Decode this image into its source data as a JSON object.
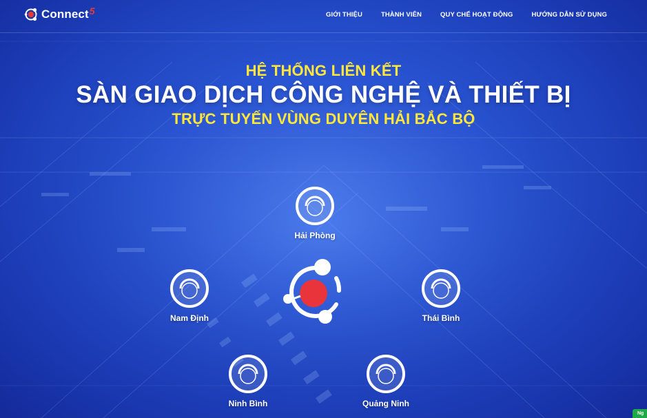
{
  "brand": {
    "name": "Connect",
    "superscript": "5"
  },
  "nav": [
    {
      "label": "GIỚI THIỆU"
    },
    {
      "label": "THÀNH VIÊN"
    },
    {
      "label": "QUY CHẾ HOẠT ĐỘNG"
    },
    {
      "label": "HƯỚNG DẪN SỬ DỤNG"
    }
  ],
  "hero": {
    "line1": "HỆ THỐNG LIÊN KẾT",
    "line2": "SÀN GIAO DỊCH CÔNG NGHỆ VÀ THIẾT BỊ",
    "line3": "TRỰC TUYẾN VÙNG DUYÊN HẢI BẮC BỘ"
  },
  "provinces": [
    {
      "name": "Hải Phòng"
    },
    {
      "name": "Nam Định"
    },
    {
      "name": "Thái Bình"
    },
    {
      "name": "Ninh Bình"
    },
    {
      "name": "Quảng Ninh"
    }
  ],
  "chat_widget": {
    "label": "Ng"
  },
  "colors": {
    "headline_accent": "#ffe63b",
    "brand_red": "#e53935",
    "background": "#2a56d6",
    "chat_green": "#1faa47"
  },
  "icons": {
    "province": "circle-arc-icon",
    "center": "connect-hub-logo-icon"
  }
}
